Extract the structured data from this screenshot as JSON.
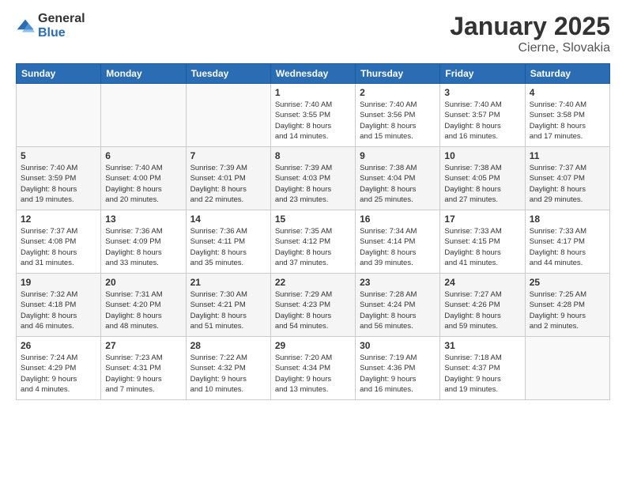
{
  "logo": {
    "general": "General",
    "blue": "Blue"
  },
  "title": {
    "month_year": "January 2025",
    "location": "Cierne, Slovakia"
  },
  "weekdays": [
    "Sunday",
    "Monday",
    "Tuesday",
    "Wednesday",
    "Thursday",
    "Friday",
    "Saturday"
  ],
  "weeks": [
    [
      {
        "day": "",
        "info": ""
      },
      {
        "day": "",
        "info": ""
      },
      {
        "day": "",
        "info": ""
      },
      {
        "day": "1",
        "info": "Sunrise: 7:40 AM\nSunset: 3:55 PM\nDaylight: 8 hours\nand 14 minutes."
      },
      {
        "day": "2",
        "info": "Sunrise: 7:40 AM\nSunset: 3:56 PM\nDaylight: 8 hours\nand 15 minutes."
      },
      {
        "day": "3",
        "info": "Sunrise: 7:40 AM\nSunset: 3:57 PM\nDaylight: 8 hours\nand 16 minutes."
      },
      {
        "day": "4",
        "info": "Sunrise: 7:40 AM\nSunset: 3:58 PM\nDaylight: 8 hours\nand 17 minutes."
      }
    ],
    [
      {
        "day": "5",
        "info": "Sunrise: 7:40 AM\nSunset: 3:59 PM\nDaylight: 8 hours\nand 19 minutes."
      },
      {
        "day": "6",
        "info": "Sunrise: 7:40 AM\nSunset: 4:00 PM\nDaylight: 8 hours\nand 20 minutes."
      },
      {
        "day": "7",
        "info": "Sunrise: 7:39 AM\nSunset: 4:01 PM\nDaylight: 8 hours\nand 22 minutes."
      },
      {
        "day": "8",
        "info": "Sunrise: 7:39 AM\nSunset: 4:03 PM\nDaylight: 8 hours\nand 23 minutes."
      },
      {
        "day": "9",
        "info": "Sunrise: 7:38 AM\nSunset: 4:04 PM\nDaylight: 8 hours\nand 25 minutes."
      },
      {
        "day": "10",
        "info": "Sunrise: 7:38 AM\nSunset: 4:05 PM\nDaylight: 8 hours\nand 27 minutes."
      },
      {
        "day": "11",
        "info": "Sunrise: 7:37 AM\nSunset: 4:07 PM\nDaylight: 8 hours\nand 29 minutes."
      }
    ],
    [
      {
        "day": "12",
        "info": "Sunrise: 7:37 AM\nSunset: 4:08 PM\nDaylight: 8 hours\nand 31 minutes."
      },
      {
        "day": "13",
        "info": "Sunrise: 7:36 AM\nSunset: 4:09 PM\nDaylight: 8 hours\nand 33 minutes."
      },
      {
        "day": "14",
        "info": "Sunrise: 7:36 AM\nSunset: 4:11 PM\nDaylight: 8 hours\nand 35 minutes."
      },
      {
        "day": "15",
        "info": "Sunrise: 7:35 AM\nSunset: 4:12 PM\nDaylight: 8 hours\nand 37 minutes."
      },
      {
        "day": "16",
        "info": "Sunrise: 7:34 AM\nSunset: 4:14 PM\nDaylight: 8 hours\nand 39 minutes."
      },
      {
        "day": "17",
        "info": "Sunrise: 7:33 AM\nSunset: 4:15 PM\nDaylight: 8 hours\nand 41 minutes."
      },
      {
        "day": "18",
        "info": "Sunrise: 7:33 AM\nSunset: 4:17 PM\nDaylight: 8 hours\nand 44 minutes."
      }
    ],
    [
      {
        "day": "19",
        "info": "Sunrise: 7:32 AM\nSunset: 4:18 PM\nDaylight: 8 hours\nand 46 minutes."
      },
      {
        "day": "20",
        "info": "Sunrise: 7:31 AM\nSunset: 4:20 PM\nDaylight: 8 hours\nand 48 minutes."
      },
      {
        "day": "21",
        "info": "Sunrise: 7:30 AM\nSunset: 4:21 PM\nDaylight: 8 hours\nand 51 minutes."
      },
      {
        "day": "22",
        "info": "Sunrise: 7:29 AM\nSunset: 4:23 PM\nDaylight: 8 hours\nand 54 minutes."
      },
      {
        "day": "23",
        "info": "Sunrise: 7:28 AM\nSunset: 4:24 PM\nDaylight: 8 hours\nand 56 minutes."
      },
      {
        "day": "24",
        "info": "Sunrise: 7:27 AM\nSunset: 4:26 PM\nDaylight: 8 hours\nand 59 minutes."
      },
      {
        "day": "25",
        "info": "Sunrise: 7:25 AM\nSunset: 4:28 PM\nDaylight: 9 hours\nand 2 minutes."
      }
    ],
    [
      {
        "day": "26",
        "info": "Sunrise: 7:24 AM\nSunset: 4:29 PM\nDaylight: 9 hours\nand 4 minutes."
      },
      {
        "day": "27",
        "info": "Sunrise: 7:23 AM\nSunset: 4:31 PM\nDaylight: 9 hours\nand 7 minutes."
      },
      {
        "day": "28",
        "info": "Sunrise: 7:22 AM\nSunset: 4:32 PM\nDaylight: 9 hours\nand 10 minutes."
      },
      {
        "day": "29",
        "info": "Sunrise: 7:20 AM\nSunset: 4:34 PM\nDaylight: 9 hours\nand 13 minutes."
      },
      {
        "day": "30",
        "info": "Sunrise: 7:19 AM\nSunset: 4:36 PM\nDaylight: 9 hours\nand 16 minutes."
      },
      {
        "day": "31",
        "info": "Sunrise: 7:18 AM\nSunset: 4:37 PM\nDaylight: 9 hours\nand 19 minutes."
      },
      {
        "day": "",
        "info": ""
      }
    ]
  ]
}
